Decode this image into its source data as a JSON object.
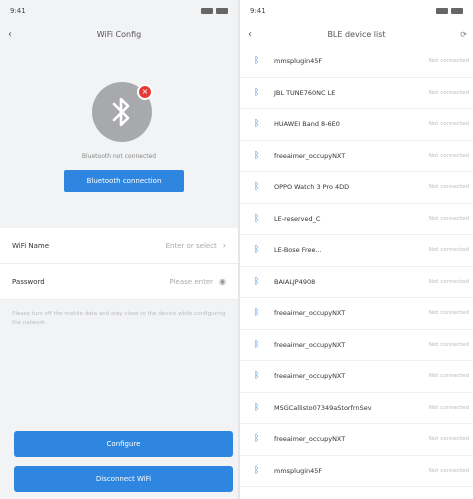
{
  "left": {
    "status_time": "9:41",
    "status_icons": "4G 4G",
    "nav_back": "‹",
    "title": "WiFi Config",
    "bt_badge": "×",
    "bt_status": "Bluetooth not connected",
    "bt_connect_label": "Bluetooth connection",
    "wifi_name_label": "WiFi Name",
    "wifi_name_placeholder": "Enter or select",
    "password_label": "Password",
    "password_placeholder": "Please enter",
    "hint": "Please turn off the mobile data and stay close to the device while configuring the network.",
    "configure_label": "Configure",
    "disconnect_label": "Disconnect WiFi"
  },
  "right": {
    "status_time": "9:41",
    "status_icons": "4G 4G",
    "nav_back": "‹",
    "title": "BLE device list",
    "nav_right": "",
    "devices": [
      {
        "name": "mmsplugin45F",
        "status": "Not connected"
      },
      {
        "name": "JBL TUNE760NC LE",
        "status": "Not connected"
      },
      {
        "name": "HUAWEI Band 8-6E0",
        "status": "Not connected"
      },
      {
        "name": "freeaimer_occupyNXT",
        "status": "Not connected"
      },
      {
        "name": "OPPO Watch 3 Pro 4DD",
        "status": "Not connected"
      },
      {
        "name": "LE-reserved_C",
        "status": "Not connected"
      },
      {
        "name": "LE-Bose Free...",
        "status": "Not connected"
      },
      {
        "name": "BAIALJP4908",
        "status": "Not connected"
      },
      {
        "name": "freeaimer_occupyNXT",
        "status": "Not connected"
      },
      {
        "name": "freeaimer_occupyNXT",
        "status": "Not connected"
      },
      {
        "name": "freeaimer_occupyNXT",
        "status": "Not connected"
      },
      {
        "name": "MSGCallisto07349aStorfrnSev",
        "status": "Not connected"
      },
      {
        "name": "freeaimer_occupyNXT",
        "status": "Not connected"
      },
      {
        "name": "mmsplugin45F",
        "status": "Not connected"
      }
    ]
  },
  "colors": {
    "accent": "#2f86e0",
    "badge": "#e53b3b",
    "bt_circle": "#a7a9ad"
  }
}
